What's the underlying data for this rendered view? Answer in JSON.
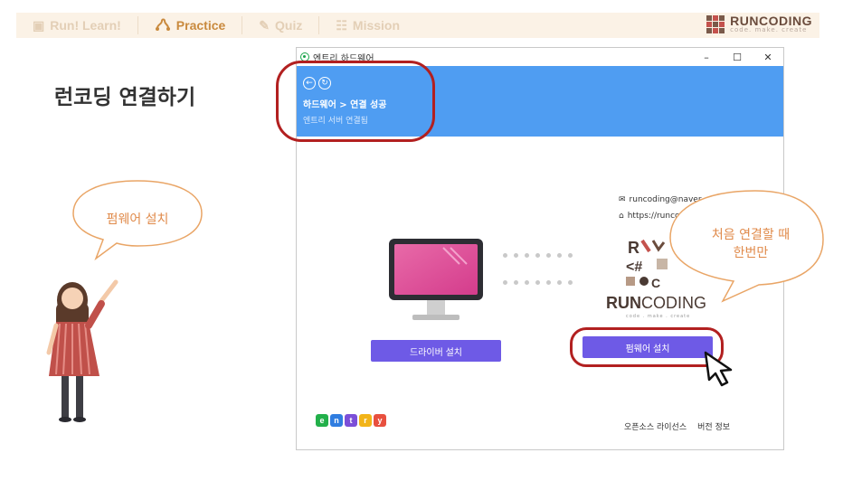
{
  "nav": {
    "items": [
      {
        "label": "Run! Learn!",
        "icon": "book-icon"
      },
      {
        "label": "Practice",
        "icon": "puzzle-icon",
        "active": true
      },
      {
        "label": "Quiz",
        "icon": "edit-icon"
      },
      {
        "label": "Mission",
        "icon": "flag-icon"
      }
    ],
    "brand_name": "RUNCODING",
    "brand_tagline": "code. make. create"
  },
  "page_title": "런코딩 연결하기",
  "bubble_left_text": "펌웨어 설치",
  "bubble_right_text_1": "처음 연결할 때",
  "bubble_right_text_2": "한번만",
  "window": {
    "title": "엔트리 하드웨어",
    "controls": [
      "–",
      "☐",
      "✕"
    ],
    "breadcrumb": "하드웨어 > 연결 성공",
    "status": "엔트리 서버 연결됨",
    "email": "runcoding@naver",
    "url": "https://runco",
    "driver_button": "드라이버 설치",
    "firmware_button": "펌웨어 설치",
    "runcoding_label_bold": "RUN",
    "runcoding_label_rest": "CODING",
    "runcoding_tagline": "code . make . create",
    "entry_letters": [
      "e",
      "n",
      "t",
      "r",
      "y"
    ],
    "footer_license": "오픈소스 라이선스",
    "footer_version": "버전 정보"
  },
  "colors": {
    "header_blue": "#4f9df2",
    "button_purple": "#6e5ae6",
    "annotation_red": "#b22020",
    "bubble_orange": "#e08a4a"
  }
}
